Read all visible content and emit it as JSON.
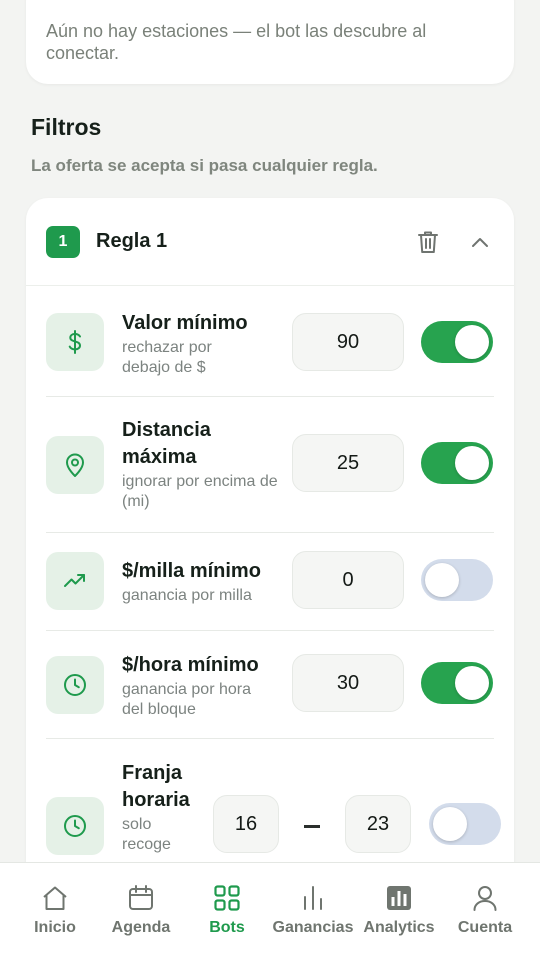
{
  "notice": {
    "text": "Aún no hay estaciones — el bot las descubre al conectar."
  },
  "filters": {
    "title": "Filtros",
    "subtitle": "La oferta se acepta si pasa cualquier regla."
  },
  "rule": {
    "number": "1",
    "title": "Regla 1",
    "rows": [
      {
        "title": "Valor mínimo",
        "desc": "rechazar por debajo de $",
        "value": "90",
        "enabled": true,
        "icon": "dollar-icon"
      },
      {
        "title": "Distancia máxima",
        "desc": "ignorar por encima de (mi)",
        "value": "25",
        "enabled": true,
        "icon": "location-pin-icon"
      },
      {
        "title": "$/milla mínimo",
        "desc": "ganancia por milla",
        "value": "0",
        "enabled": false,
        "icon": "trending-up-icon"
      },
      {
        "title": "$/hora mínimo",
        "desc": "ganancia por hora del bloque",
        "value": "30",
        "enabled": true,
        "icon": "clock-icon"
      }
    ],
    "time_window": {
      "title": "Franja horaria",
      "desc": "solo recoge",
      "from": "16",
      "separator": "–",
      "to": "23",
      "enabled": false,
      "icon": "clock-icon"
    }
  },
  "nav": {
    "items": [
      {
        "label": "Inicio",
        "icon": "home-icon",
        "active": false
      },
      {
        "label": "Agenda",
        "icon": "calendar-icon",
        "active": false
      },
      {
        "label": "Bots",
        "icon": "grid-icon",
        "active": true
      },
      {
        "label": "Ganancias",
        "icon": "bars-icon",
        "active": false
      },
      {
        "label": "Analytics",
        "icon": "analytics-icon",
        "active": false
      },
      {
        "label": "Cuenta",
        "icon": "user-icon",
        "active": false
      }
    ]
  },
  "colors": {
    "accent": "#1f9a4d",
    "toggle_on": "#27a34f",
    "toggle_off": "#d3dceb",
    "icon_tile": "#e5f1e7"
  }
}
